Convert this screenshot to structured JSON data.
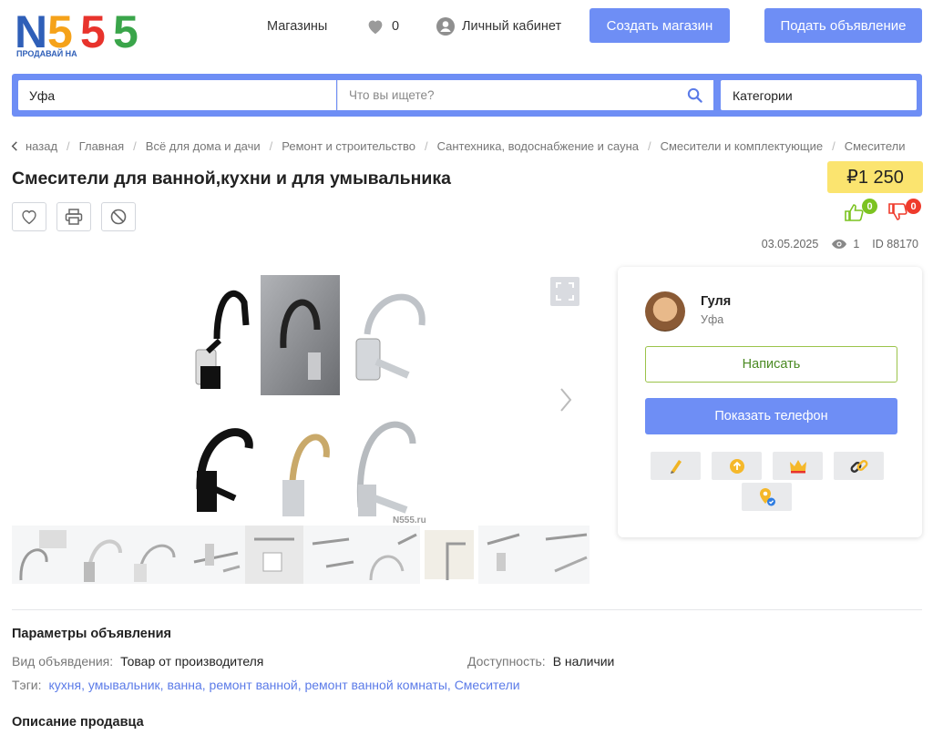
{
  "header": {
    "logo_text": "N555",
    "logo_tagline": "ПРОДАВАЙ НА",
    "nav_shops": "Магазины",
    "favorites_count": "0",
    "account_label": "Личный кабинет",
    "create_shop": "Создать магазин",
    "post_ad": "Подать объявление"
  },
  "search": {
    "city": "Уфа",
    "query_placeholder": "Что вы ищете?",
    "categories": "Категории"
  },
  "breadcrumb": [
    "назад",
    "Главная",
    "Всё для дома и дачи",
    "Ремонт и строительство",
    "Сантехника, водоснабжение и сауна",
    "Смесители и комплектующие",
    "Смесители"
  ],
  "listing": {
    "title": "Смесители для ванной,кухни и для умывальника",
    "price": "₽1 250",
    "likes": "0",
    "dislikes": "0",
    "date": "03.05.2025",
    "views": "1",
    "id": "ID 88170",
    "watermark": "N555.ru"
  },
  "seller": {
    "name": "Гуля",
    "city": "Уфа",
    "write_button": "Написать",
    "phone_button": "Показать телефон"
  },
  "params": {
    "title": "Параметры объявления",
    "ad_type_label": "Вид объявдения:",
    "ad_type_value": "Товар от производителя",
    "availability_label": "Доступность:",
    "availability_value": "В наличии",
    "tags_label": "Тэги:",
    "tags": [
      "кухня",
      "умывальник",
      "ванна",
      "ремонт ванной",
      "ремонт ванной комнаты",
      "Смесители"
    ]
  },
  "description_title": "Описание продавца",
  "colors": {
    "accent": "#6e8ef5",
    "price_bg": "#fbe46f",
    "like_green": "#7cc321",
    "dislike_red": "#ef3b2c"
  }
}
